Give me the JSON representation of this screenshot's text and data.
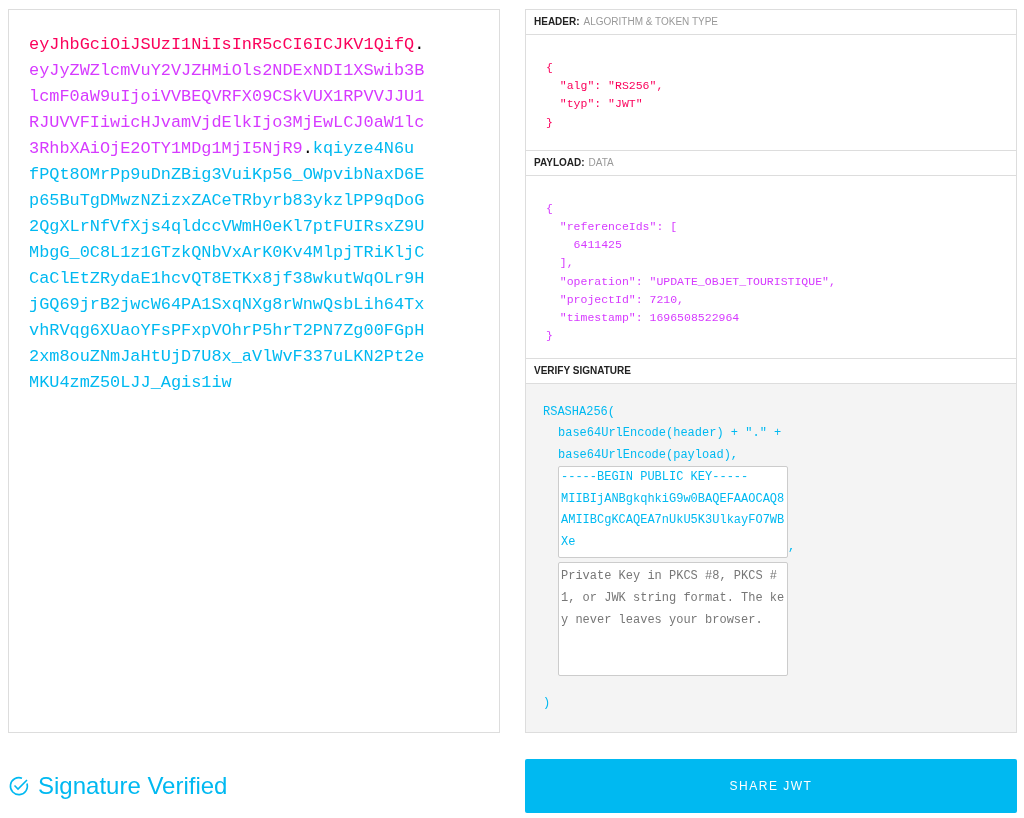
{
  "encoded": {
    "parts": [
      {
        "kind": "segment",
        "text": "eyJhbGciOiJSUzI1NiIsInR5cCI6ICJKV1QifQ",
        "color": "#fb015b"
      },
      {
        "kind": "separator",
        "text": "."
      },
      {
        "kind": "segment",
        "text": "eyJyZWZlcmVuY2VJZHMiOls2NDExNDI1XSwib3BlcmF0aW9uIjoiVVBEQVRFX09CSkVUX1RPVVJJU1RJUVVFIiwicHJvamVjdElkIjo3MjEwLCJ0aW1lc3RhbXAiOjE2OTY1MDg1MjI5NjR9",
        "color": "#d63aff"
      },
      {
        "kind": "separator",
        "text": "."
      },
      {
        "kind": "segment",
        "text": "kqiyze4N6ufPQt8OMrPp9uDnZBig3VuiKp56_OWpvibNaxD6Ep65BuTgDMwzNZizxZACeTRbyrb83ykzlPP9qDoG2QgXLrNfVfXjs4qldccVWmH0eKl7ptFUIRsxZ9UMbgG_0C8L1z1GTzkQNbVxArK0Kv4MlpjTRiKljCCaClEtZRydaE1hcvQT8ETKx8jf38wkutWqOLr9HjGQ69jrB2jwcW64PA1SxqNXg8rWnwQsbLih64TxvhRVqg6XUaoYFsPFxpVOhrP5hrT2PN7Zg00FGpH2xm8ouZNmJaHtUjD7U8x_aVlWvF337uLKN2Pt2eMKU4zmZ50LJJ_Agis1iw",
        "color": "#00b9f1"
      }
    ]
  },
  "decoded": {
    "sections": [
      {
        "kind": "json",
        "title": "HEADER:",
        "subtitle": "ALGORITHM & TOKEN TYPE",
        "color": "#fb015b",
        "code": "{\n  \"alg\": \"RS256\",\n  \"typ\": \"JWT\"\n}"
      },
      {
        "kind": "json",
        "title": "PAYLOAD:",
        "subtitle": "DATA",
        "color": "#d63aff",
        "code": "{\n  \"referenceIds\": [\n    6411425\n  ],\n  \"operation\": \"UPDATE_OBJET_TOURISTIQUE\",\n  \"projectId\": 7210,\n  \"timestamp\": 1696508522964\n}"
      },
      {
        "kind": "verify",
        "title": "VERIFY SIGNATURE",
        "color": "#00b9f1",
        "function_open": "RSASHA256(",
        "arg_lines": [
          "base64UrlEncode(header) + \".\" +",
          "base64UrlEncode(payload),"
        ],
        "public_key": "-----BEGIN PUBLIC KEY-----\nMIIBIjANBgkqhkiG9w0BAQEFAAOCAQ8AMIIBCgKCAQEA7nUkU5K3UlkayFO7WBXe",
        "comma": ",",
        "private_key": {
          "placeholder": "Private Key in PKCS #8, PKCS #1, or JWK string format. The key never leaves your browser."
        },
        "function_close": ")"
      }
    ]
  },
  "status": {
    "verified": true,
    "text": "Signature Verified"
  },
  "share_button": "SHARE JWT"
}
